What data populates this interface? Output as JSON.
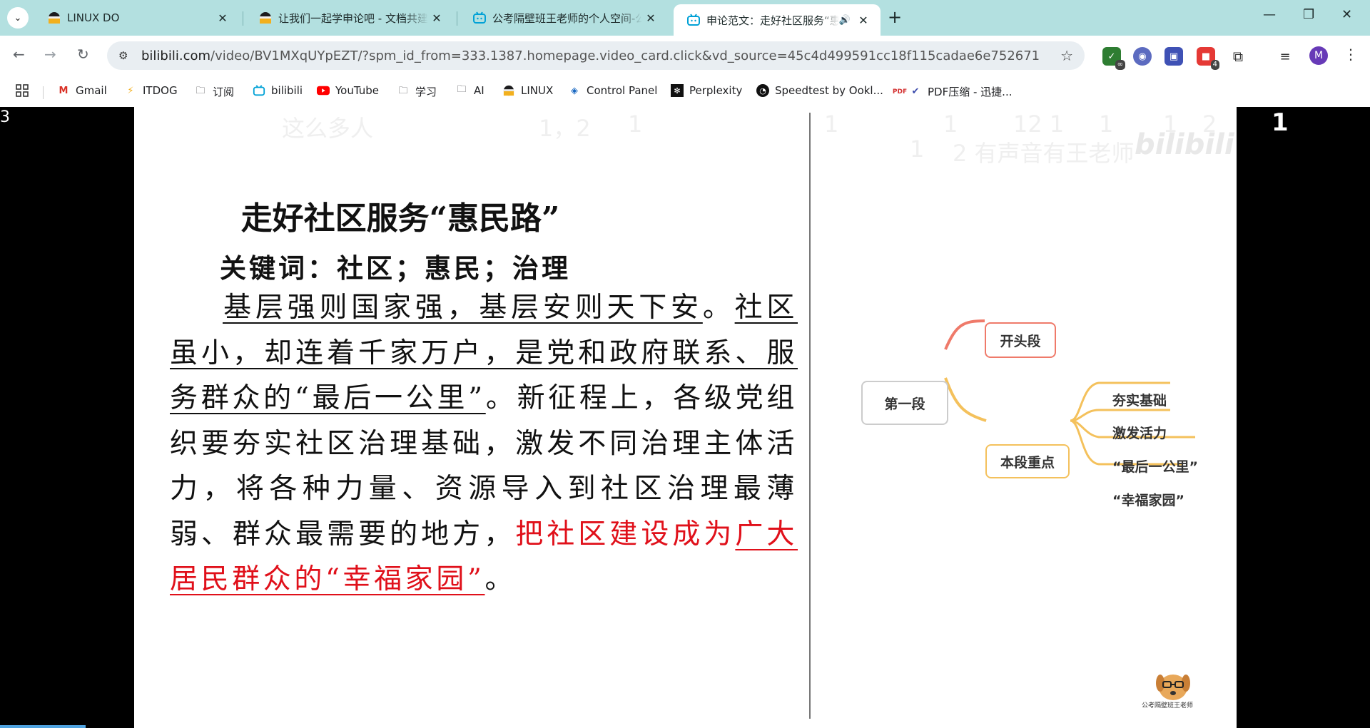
{
  "tabs": [
    {
      "title": "LINUX DO",
      "icon": "linuxdo-icon"
    },
    {
      "title": "让我们一起学申论吧 - 文档共建",
      "icon": "linuxdo-icon"
    },
    {
      "title": "公考隔壁班王老师的个人空间-公考隔壁班王老师个人主页",
      "icon": "bilibili-icon"
    },
    {
      "title": "申论范文：走好社区服务“惠民路”",
      "icon": "bilibili-icon",
      "active": true
    }
  ],
  "address": {
    "domain": "bilibili.com",
    "path": "/video/BV1MXqUYpEZT/?spm_id_from=333.1387.homepage.video_card.click&vd_source=45c4d499591cc18f115cadae6e752671"
  },
  "extensions": {
    "badge_infinity": "∞",
    "badge_count": "4"
  },
  "profile_initial": "M",
  "bookmarks": [
    {
      "label": "Gmail",
      "icon": "gmail-icon"
    },
    {
      "label": "ITDOG",
      "icon": "itdog-icon"
    },
    {
      "label": "订阅",
      "icon": "folder-icon"
    },
    {
      "label": "bilibili",
      "icon": "bilibili-icon"
    },
    {
      "label": "YouTube",
      "icon": "youtube-icon"
    },
    {
      "label": "学习",
      "icon": "folder-icon"
    },
    {
      "label": "AI",
      "icon": "folder-icon"
    },
    {
      "label": "LINUX",
      "icon": "linuxdo-icon"
    },
    {
      "label": "Control Panel",
      "icon": "control-panel-icon"
    },
    {
      "label": "Perplexity",
      "icon": "perplexity-icon"
    },
    {
      "label": "Speedtest by Ookl...",
      "icon": "speedtest-icon"
    },
    {
      "label": "PDF压缩 - 迅捷...",
      "icon": "pdf-icon"
    }
  ],
  "video": {
    "corner_number": "1",
    "danmaku": [
      "这么多人",
      "1，2",
      "1",
      "1",
      "1",
      "12 1",
      "1",
      "1",
      "2",
      "1",
      "2 有声音有王老师"
    ],
    "watermark": "bilibili",
    "doc": {
      "title": "走好社区服务“惠民路”",
      "keywords": "关键词：社区；惠民；治理",
      "p_u1": "基层强则国家强，基层安则天下安",
      "p_t1": "。",
      "p_u2": "社区虽小，却连着千家万户，是党和政府联系、服务群众的“最后一公里”",
      "p_t2": "。新征程上，各级党组织要夯实社区治理基础，激发不同治理主体活力，将各种力量、资源导入到社区治理最薄弱、群众最需要的地方，",
      "p_r1": "把社区建设成为",
      "p_r2": "广大居民群众的“幸福家园”",
      "p_t3": "。"
    },
    "mindmap": {
      "root": "第一段",
      "branch1": "开头段",
      "branch2": "本段重点",
      "leaves": [
        "夯实基础",
        "激发活力",
        "“最后一公里”",
        "“幸福家园”"
      ]
    },
    "mascot_caption": "公考隔壁班王老师"
  },
  "colors": {
    "tabbar": "#b3e0e0",
    "accent_red": "#e0101a",
    "mindmap_orange": "#f4c15c",
    "mindmap_red": "#ef7a6a"
  }
}
